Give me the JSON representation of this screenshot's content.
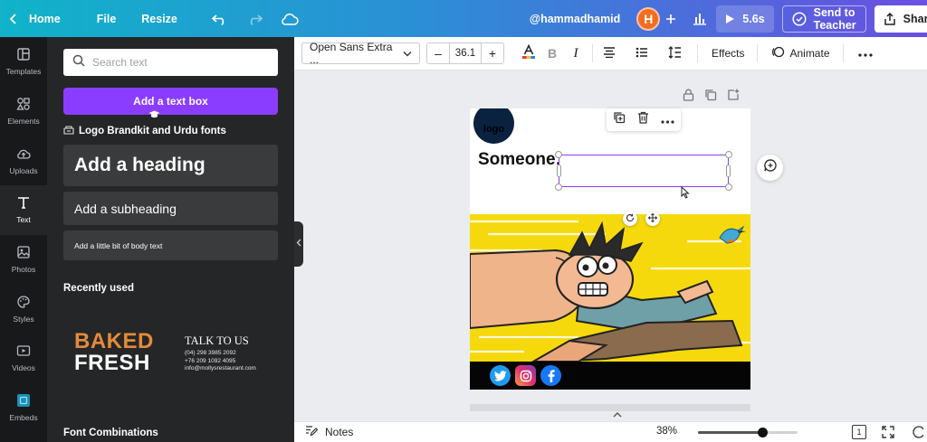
{
  "topbar": {
    "home": "Home",
    "file": "File",
    "resize": "Resize",
    "username": "@hammadhamid",
    "avatar_initial": "H",
    "play_duration": "5.6s",
    "send_to_teacher": "Send to Teacher",
    "share": "Share"
  },
  "rail": {
    "items": [
      {
        "label": "Templates",
        "icon": "templates-icon"
      },
      {
        "label": "Elements",
        "icon": "elements-icon"
      },
      {
        "label": "Uploads",
        "icon": "uploads-icon"
      },
      {
        "label": "Text",
        "icon": "text-icon"
      },
      {
        "label": "Photos",
        "icon": "photos-icon"
      },
      {
        "label": "Styles",
        "icon": "styles-icon"
      },
      {
        "label": "Videos",
        "icon": "videos-icon"
      },
      {
        "label": "Embeds",
        "icon": "embeds-icon"
      }
    ],
    "active": "Text"
  },
  "panel": {
    "search_placeholder": "Search text",
    "add_text_box": "Add a text box",
    "brandkit_title": "Logo Brandkit and Urdu fonts",
    "add_heading": "Add a heading",
    "add_subheading": "Add a subheading",
    "add_body": "Add a little bit of body text",
    "recently_used": "Recently used",
    "recent_card": {
      "baked": "BAKED",
      "fresh": "FRESH",
      "talk_title": "TALK TO US",
      "line1": "(04) 298 3985 2092",
      "line2": "+76 209 1092 4095",
      "line3": "info@mollysrestaurant.com"
    },
    "font_combinations": "Font Combinations"
  },
  "toolbar": {
    "font_name": "Open Sans Extra ...",
    "font_size": "36.1",
    "minus": "–",
    "plus": "+",
    "effects": "Effects",
    "animate": "Animate"
  },
  "canvas": {
    "logo_text": "logo",
    "someone_text": "Someone:"
  },
  "bottombar": {
    "notes": "Notes",
    "zoom": "38%",
    "zoom_fraction": 0.38,
    "page_count": "1"
  },
  "colors": {
    "accent_purple": "#8b3dff",
    "avatar_orange": "#f36d21",
    "comic_yellow": "#f6d90c"
  }
}
